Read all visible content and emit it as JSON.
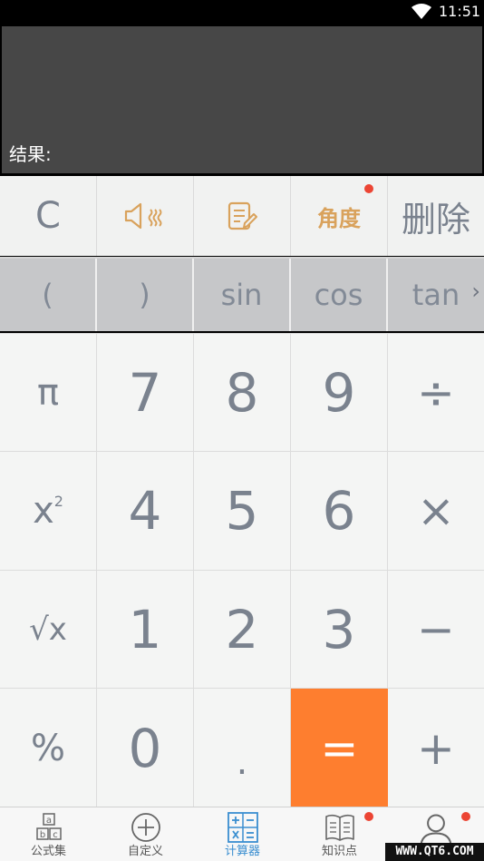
{
  "status_bar": {
    "time": "11:51",
    "icons": [
      "wifi-icon"
    ]
  },
  "display": {
    "result_label": "结果:"
  },
  "function_row": {
    "clear": "C",
    "sound_icon": "speaker-icon",
    "history_icon": "notes-edit-icon",
    "angle": "角度",
    "delete": "删除"
  },
  "scientific_row": {
    "open_paren": "(",
    "close_paren": ")",
    "sin": "sin",
    "cos": "cos",
    "tan": "tan",
    "more": "›"
  },
  "keypad": {
    "pi": "π",
    "seven": "7",
    "eight": "8",
    "nine": "9",
    "divide": "÷",
    "square_base": "x",
    "square_exp": "2",
    "four": "4",
    "five": "5",
    "six": "6",
    "multiply": "×",
    "sqrt": "√x",
    "one": "1",
    "two": "2",
    "three": "3",
    "minus": "−",
    "percent": "%",
    "zero": "0",
    "dot": ".",
    "equals": "=",
    "plus": "+"
  },
  "tab_bar": {
    "tabs": [
      {
        "label": "公式集",
        "icon": "formula-blocks-icon",
        "active": false
      },
      {
        "label": "自定义",
        "icon": "plus-circle-icon",
        "active": false
      },
      {
        "label": "计算器",
        "icon": "calculator-icon",
        "active": true
      },
      {
        "label": "知识点",
        "icon": "book-icon",
        "active": false
      },
      {
        "label": "",
        "icon": "user-icon",
        "active": false
      }
    ]
  },
  "colors": {
    "display_bg": "#474747",
    "accent_orange": "#fe7e2f",
    "function_icon_orange": "#d9a25c",
    "badge_red": "#ec4534",
    "active_tab_blue": "#3a8ed0",
    "key_text_gray": "#7a828e"
  },
  "watermark": "WWW.QT6.COM"
}
